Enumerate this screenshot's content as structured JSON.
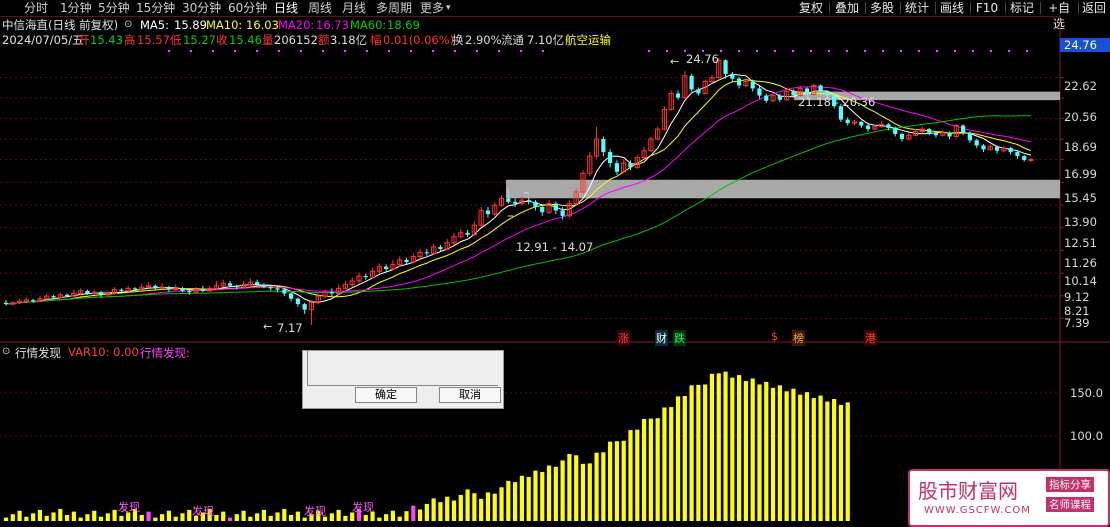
{
  "toolbar": {
    "timeframes": [
      "分时",
      "1分钟",
      "5分钟",
      "15分钟",
      "30分钟",
      "60分钟",
      "日线",
      "周线",
      "月线",
      "多周期",
      "更多"
    ],
    "active_timeframe": "日线",
    "more_arrow": "▾",
    "right_buttons": [
      "复权",
      "叠加",
      "多股",
      "统计",
      "画线",
      "F10",
      "标记",
      "+自选",
      "返回"
    ]
  },
  "stock": {
    "title": "中信海直(日线 前复权)",
    "ma5_label": "MA5:",
    "ma5": "15.89",
    "ma10_label": "MA10:",
    "ma10": "16.03",
    "ma20_label": "MA20:",
    "ma20": "16.73",
    "ma60_label": "MA60:",
    "ma60": "18.69",
    "date": "2024/07/05/五",
    "open_label": "开",
    "open": "15.43",
    "high_label": "高",
    "high": "15.57",
    "low_label": "低",
    "low": "15.27",
    "close_label": "收",
    "close": "15.46",
    "volume_label": "量",
    "volume": "206152",
    "amount_label": "额",
    "amount": "3.18亿",
    "change_label": "幅",
    "change": "0.01(0.06%)",
    "turnover_label": "换",
    "turnover": "2.90%",
    "float_label": "流通",
    "float_cap": "7.10亿",
    "sector": "航空运输"
  },
  "price_axis": {
    "current": "24.76",
    "ticks": [
      "22.62",
      "20.56",
      "18.69",
      "16.99",
      "15.45",
      "13.90",
      "12.51",
      "11.26",
      "10.14",
      "9.12",
      "8.21",
      "7.39"
    ]
  },
  "annotations": {
    "high_mark": "24.76",
    "low_mark": "7.17",
    "upper_zone": "21.18 - 20.36",
    "lower_zone": "12.91 - 14.07"
  },
  "event_tags": [
    "涨",
    "财",
    "跌",
    "$",
    "榜",
    "港"
  ],
  "indicator": {
    "name": "行情发现",
    "var10": "VAR10: 0.00",
    "var_name": "行情发现:",
    "ticks": [
      "150.0",
      "100.0"
    ],
    "discover_labels": [
      "发现",
      "发现",
      "发现",
      "发现"
    ]
  },
  "dialog": {
    "ok": "确定",
    "cancel": "取消"
  },
  "logo": {
    "title": "股市财富网",
    "tag1": "指标分享",
    "tag2": "名师课程",
    "url": "WWW.GSCFW.COM"
  },
  "colors": {
    "up": "#ff3232",
    "down": "#54ffff",
    "ma5": "#ffffff",
    "ma10": "#ffff00",
    "ma20": "#ff00ff",
    "ma60": "#00c000",
    "zone": "#a8a8a8",
    "bar": "#ffff00"
  },
  "chart_data": {
    "type": "candlestick",
    "candles": [
      [
        7.95,
        7.9,
        8.05,
        7.85
      ],
      [
        7.9,
        7.95,
        8.0,
        7.85
      ],
      [
        7.95,
        8.0,
        8.1,
        7.9
      ],
      [
        8.0,
        8.05,
        8.15,
        7.95
      ],
      [
        8.05,
        8.0,
        8.1,
        7.95
      ],
      [
        8.0,
        8.1,
        8.2,
        7.95
      ],
      [
        8.1,
        8.2,
        8.3,
        8.05
      ],
      [
        8.2,
        8.15,
        8.25,
        8.1
      ],
      [
        8.15,
        8.25,
        8.35,
        8.1
      ],
      [
        8.25,
        8.2,
        8.3,
        8.15
      ],
      [
        8.2,
        8.3,
        8.45,
        8.15
      ],
      [
        8.3,
        8.4,
        8.5,
        8.25
      ],
      [
        8.4,
        8.3,
        8.45,
        8.25
      ],
      [
        8.3,
        8.35,
        8.45,
        8.25
      ],
      [
        8.35,
        8.25,
        8.4,
        8.15
      ],
      [
        8.25,
        8.3,
        8.4,
        8.2
      ],
      [
        8.3,
        8.45,
        8.55,
        8.25
      ],
      [
        8.45,
        8.4,
        8.5,
        8.35
      ],
      [
        8.4,
        8.5,
        8.6,
        8.35
      ],
      [
        8.5,
        8.45,
        8.55,
        8.4
      ],
      [
        8.45,
        8.55,
        8.7,
        8.4
      ],
      [
        8.55,
        8.6,
        8.75,
        8.5
      ],
      [
        8.6,
        8.5,
        8.65,
        8.45
      ],
      [
        8.5,
        8.55,
        8.7,
        8.45
      ],
      [
        8.55,
        8.45,
        8.6,
        8.35
      ],
      [
        8.45,
        8.5,
        8.65,
        8.4
      ],
      [
        8.5,
        8.4,
        8.55,
        8.35
      ],
      [
        8.4,
        8.35,
        8.45,
        8.25
      ],
      [
        8.35,
        8.45,
        8.55,
        8.3
      ],
      [
        8.45,
        8.4,
        8.6,
        8.35
      ],
      [
        8.4,
        8.5,
        8.6,
        8.35
      ],
      [
        8.5,
        8.6,
        8.8,
        8.45
      ],
      [
        8.6,
        8.7,
        8.85,
        8.55
      ],
      [
        8.7,
        8.6,
        8.8,
        8.55
      ],
      [
        8.6,
        8.55,
        8.65,
        8.45
      ],
      [
        8.55,
        8.65,
        8.8,
        8.5
      ],
      [
        8.65,
        8.75,
        8.9,
        8.6
      ],
      [
        8.75,
        8.65,
        8.85,
        8.6
      ],
      [
        8.65,
        8.55,
        8.7,
        8.5
      ],
      [
        8.55,
        8.5,
        8.65,
        8.4
      ],
      [
        8.5,
        8.45,
        8.55,
        8.35
      ],
      [
        8.45,
        8.3,
        8.5,
        8.2
      ],
      [
        8.3,
        8.1,
        8.35,
        8.0
      ],
      [
        8.1,
        7.9,
        8.15,
        7.8
      ],
      [
        7.9,
        7.7,
        7.95,
        7.55
      ],
      [
        7.7,
        7.95,
        8.05,
        7.17
      ],
      [
        7.95,
        8.2,
        8.3,
        7.9
      ],
      [
        8.2,
        8.35,
        8.45,
        8.1
      ],
      [
        8.35,
        8.3,
        8.5,
        8.2
      ],
      [
        8.3,
        8.5,
        8.65,
        8.25
      ],
      [
        8.5,
        8.65,
        8.8,
        8.45
      ],
      [
        8.65,
        8.8,
        8.95,
        8.55
      ],
      [
        8.8,
        9.0,
        9.15,
        8.7
      ],
      [
        9.0,
        8.95,
        9.1,
        8.85
      ],
      [
        8.95,
        9.2,
        9.35,
        8.9
      ],
      [
        9.2,
        9.4,
        9.55,
        9.1
      ],
      [
        9.4,
        9.3,
        9.5,
        9.2
      ],
      [
        9.3,
        9.5,
        9.7,
        9.25
      ],
      [
        9.5,
        9.7,
        9.85,
        9.4
      ],
      [
        9.7,
        9.6,
        9.8,
        9.5
      ],
      [
        9.6,
        9.85,
        10.0,
        9.55
      ],
      [
        9.85,
        10.05,
        10.2,
        9.75
      ],
      [
        10.05,
        10.0,
        10.2,
        9.9
      ],
      [
        10.0,
        10.3,
        10.45,
        9.95
      ],
      [
        10.3,
        10.2,
        10.4,
        10.1
      ],
      [
        10.2,
        10.5,
        10.7,
        10.15
      ],
      [
        10.5,
        10.8,
        11.0,
        10.4
      ],
      [
        10.8,
        11.0,
        11.2,
        10.7
      ],
      [
        11.0,
        10.9,
        11.15,
        10.8
      ],
      [
        10.9,
        11.4,
        11.6,
        10.85
      ],
      [
        11.4,
        12.2,
        12.4,
        11.3
      ],
      [
        12.2,
        12.0,
        12.4,
        11.8
      ],
      [
        12.0,
        12.5,
        12.7,
        11.9
      ],
      [
        12.5,
        12.9,
        13.1,
        12.4
      ],
      [
        12.9,
        12.7,
        13.5,
        12.6
      ],
      [
        12.7,
        12.6,
        12.9,
        12.4
      ],
      [
        12.6,
        12.8,
        13.0,
        12.5
      ],
      [
        12.8,
        12.7,
        12.95,
        12.55
      ],
      [
        12.7,
        12.4,
        12.8,
        12.2
      ],
      [
        12.4,
        12.1,
        12.5,
        11.9
      ],
      [
        12.1,
        12.6,
        12.8,
        12.0
      ],
      [
        12.6,
        12.2,
        12.7,
        12.0
      ],
      [
        12.2,
        11.9,
        12.4,
        11.7
      ],
      [
        11.9,
        12.6,
        12.8,
        11.8
      ],
      [
        12.6,
        13.3,
        13.5,
        12.5
      ],
      [
        13.3,
        14.5,
        14.7,
        13.2
      ],
      [
        14.5,
        15.7,
        16.0,
        14.3
      ],
      [
        15.7,
        17.0,
        18.0,
        15.5
      ],
      [
        17.0,
        16.0,
        17.2,
        15.7
      ],
      [
        16.0,
        15.2,
        16.2,
        14.9
      ],
      [
        15.2,
        14.6,
        15.4,
        14.4
      ],
      [
        14.6,
        15.2,
        15.5,
        14.5
      ],
      [
        15.2,
        14.9,
        15.4,
        14.7
      ],
      [
        14.9,
        15.6,
        15.8,
        14.8
      ],
      [
        15.6,
        16.1,
        16.4,
        15.5
      ],
      [
        16.1,
        17.0,
        17.2,
        16.0
      ],
      [
        17.0,
        17.8,
        18.0,
        16.9
      ],
      [
        17.8,
        19.5,
        19.8,
        17.7
      ],
      [
        19.5,
        21.0,
        21.3,
        19.4
      ],
      [
        21.0,
        20.6,
        21.3,
        20.4
      ],
      [
        20.6,
        22.8,
        23.3,
        20.5
      ],
      [
        22.8,
        21.4,
        23.0,
        21.2
      ],
      [
        21.4,
        21.0,
        21.6,
        20.8
      ],
      [
        21.0,
        22.2,
        22.4,
        20.9
      ],
      [
        22.2,
        22.6,
        22.9,
        22.0
      ],
      [
        22.6,
        24.5,
        24.76,
        22.5
      ],
      [
        24.5,
        23.0,
        24.6,
        22.5
      ],
      [
        23.0,
        22.5,
        23.2,
        22.2
      ],
      [
        22.5,
        21.8,
        22.7,
        21.5
      ],
      [
        21.8,
        22.2,
        22.5,
        21.6
      ],
      [
        22.2,
        21.5,
        22.4,
        21.2
      ],
      [
        21.5,
        20.8,
        21.7,
        20.5
      ],
      [
        20.8,
        20.3,
        21.0,
        20.1
      ],
      [
        20.3,
        20.8,
        21.0,
        20.2
      ],
      [
        20.8,
        20.4,
        21.0,
        20.2
      ],
      [
        20.4,
        21.2,
        21.4,
        20.3
      ],
      [
        21.2,
        20.8,
        21.4,
        20.6
      ],
      [
        20.8,
        21.5,
        21.8,
        20.7
      ],
      [
        21.5,
        20.9,
        21.6,
        20.6
      ],
      [
        20.9,
        21.8,
        22.0,
        20.8
      ],
      [
        21.8,
        21.2,
        21.9,
        21.0
      ],
      [
        21.2,
        20.8,
        21.3,
        20.6
      ],
      [
        20.8,
        19.8,
        21.0,
        19.6
      ],
      [
        19.8,
        18.6,
        20.0,
        18.4
      ],
      [
        18.6,
        18.3,
        18.8,
        18.1
      ],
      [
        18.3,
        18.4,
        18.6,
        18.1
      ],
      [
        18.4,
        18.1,
        18.5,
        17.9
      ],
      [
        18.1,
        17.8,
        18.2,
        17.6
      ],
      [
        17.8,
        18.0,
        18.2,
        17.7
      ],
      [
        18.0,
        18.2,
        18.5,
        17.9
      ],
      [
        18.2,
        17.9,
        18.3,
        17.7
      ],
      [
        17.9,
        17.4,
        18.0,
        17.2
      ],
      [
        17.4,
        17.0,
        17.5,
        16.8
      ],
      [
        17.0,
        17.3,
        17.5,
        16.9
      ],
      [
        17.3,
        17.6,
        17.8,
        17.2
      ],
      [
        17.6,
        17.8,
        18.0,
        17.5
      ],
      [
        17.8,
        17.5,
        17.9,
        17.3
      ],
      [
        17.5,
        17.3,
        17.6,
        17.1
      ],
      [
        17.3,
        17.5,
        17.7,
        17.2
      ],
      [
        17.5,
        17.2,
        17.6,
        17.0
      ],
      [
        17.2,
        18.1,
        18.2,
        17.1
      ],
      [
        18.1,
        17.5,
        18.2,
        17.3
      ],
      [
        17.5,
        16.9,
        17.6,
        16.7
      ],
      [
        16.9,
        16.5,
        17.0,
        16.3
      ],
      [
        16.5,
        16.2,
        16.6,
        16.0
      ],
      [
        16.2,
        16.4,
        16.6,
        16.1
      ],
      [
        16.4,
        16.1,
        16.5,
        15.9
      ],
      [
        16.1,
        16.3,
        16.5,
        16.0
      ],
      [
        16.3,
        16.0,
        16.4,
        15.8
      ],
      [
        16.0,
        15.7,
        16.1,
        15.5
      ],
      [
        15.7,
        15.43,
        15.8,
        15.3
      ],
      [
        15.43,
        15.46,
        15.57,
        15.27
      ]
    ],
    "zones": [
      {
        "label": "21.18 - 20.36",
        "low": 20.36,
        "high": 21.18
      },
      {
        "label": "12.91 - 14.07",
        "low": 12.91,
        "high": 14.07
      }
    ]
  }
}
